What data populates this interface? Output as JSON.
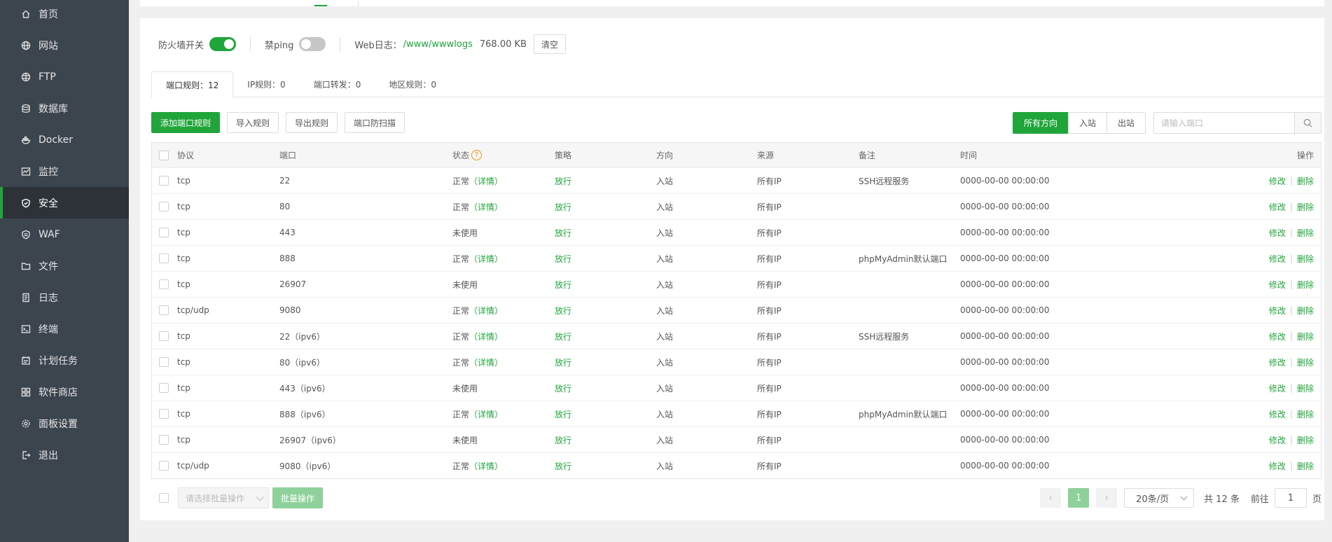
{
  "sidebar": {
    "items": [
      {
        "label": "首页",
        "icon": "home-icon",
        "active": false
      },
      {
        "label": "网站",
        "icon": "globe-icon",
        "active": false
      },
      {
        "label": "FTP",
        "icon": "ftp-globe-icon",
        "active": false
      },
      {
        "label": "数据库",
        "icon": "database-icon",
        "active": false
      },
      {
        "label": "Docker",
        "icon": "docker-icon",
        "active": false
      },
      {
        "label": "监控",
        "icon": "monitor-icon",
        "active": false
      },
      {
        "label": "安全",
        "icon": "shield-icon",
        "active": true
      },
      {
        "label": "WAF",
        "icon": "waf-shield-icon",
        "active": false
      },
      {
        "label": "文件",
        "icon": "folder-icon",
        "active": false
      },
      {
        "label": "日志",
        "icon": "log-icon",
        "active": false
      },
      {
        "label": "终端",
        "icon": "terminal-icon",
        "active": false
      },
      {
        "label": "计划任务",
        "icon": "task-icon",
        "active": false
      },
      {
        "label": "软件商店",
        "icon": "store-icon",
        "active": false
      },
      {
        "label": "面板设置",
        "icon": "gear-icon",
        "active": false
      },
      {
        "label": "退出",
        "icon": "logout-icon",
        "active": false
      }
    ]
  },
  "firewall": {
    "switch_label": "防火墙开关",
    "switch_on": true,
    "ping_label": "禁ping",
    "ping_on": false,
    "weblog_label": "Web日志：",
    "weblog_path": "/www/wwwlogs",
    "weblog_size": "768.00 KB",
    "clear_label": "清空"
  },
  "rule_tabs": [
    {
      "label": "端口规则：12",
      "active": true
    },
    {
      "label": "IP规则：0",
      "active": false
    },
    {
      "label": "端口转发：0",
      "active": false
    },
    {
      "label": "地区规则：0",
      "active": false
    }
  ],
  "toolbar": {
    "add_label": "添加端口规则",
    "import_label": "导入规则",
    "export_label": "导出规则",
    "scan_label": "端口防扫描"
  },
  "direction": {
    "all_label": "所有方向",
    "in_label": "入站",
    "out_label": "出站"
  },
  "search": {
    "placeholder": "请输入端口"
  },
  "table": {
    "headers": {
      "protocol": "协议",
      "port": "端口",
      "status": "状态",
      "policy": "策略",
      "direction": "方向",
      "source": "来源",
      "remark": "备注",
      "time": "时间",
      "ops": "操作"
    },
    "help_glyph": "?",
    "edit_label": "修改",
    "delete_label": "删除",
    "op_sep": "|",
    "rows": [
      {
        "protocol": "tcp",
        "port": "22",
        "status": "正常",
        "detail": "（详情）",
        "policy": "放行",
        "direction": "入站",
        "source": "所有IP",
        "remark": "SSH远程服务",
        "time": "0000-00-00 00:00:00"
      },
      {
        "protocol": "tcp",
        "port": "80",
        "status": "正常",
        "detail": "（详情）",
        "policy": "放行",
        "direction": "入站",
        "source": "所有IP",
        "remark": "",
        "time": "0000-00-00 00:00:00"
      },
      {
        "protocol": "tcp",
        "port": "443",
        "status": "未使用",
        "detail": "",
        "policy": "放行",
        "direction": "入站",
        "source": "所有IP",
        "remark": "",
        "time": "0000-00-00 00:00:00"
      },
      {
        "protocol": "tcp",
        "port": "888",
        "status": "正常",
        "detail": "（详情）",
        "policy": "放行",
        "direction": "入站",
        "source": "所有IP",
        "remark": "phpMyAdmin默认端口",
        "time": "0000-00-00 00:00:00"
      },
      {
        "protocol": "tcp",
        "port": "26907",
        "status": "未使用",
        "detail": "",
        "policy": "放行",
        "direction": "入站",
        "source": "所有IP",
        "remark": "",
        "time": "0000-00-00 00:00:00"
      },
      {
        "protocol": "tcp/udp",
        "port": "9080",
        "status": "正常",
        "detail": "（详情）",
        "policy": "放行",
        "direction": "入站",
        "source": "所有IP",
        "remark": "",
        "time": "0000-00-00 00:00:00"
      },
      {
        "protocol": "tcp",
        "port": "22（ipv6）",
        "status": "正常",
        "detail": "（详情）",
        "policy": "放行",
        "direction": "入站",
        "source": "所有IP",
        "remark": "SSH远程服务",
        "time": "0000-00-00 00:00:00"
      },
      {
        "protocol": "tcp",
        "port": "80（ipv6）",
        "status": "正常",
        "detail": "（详情）",
        "policy": "放行",
        "direction": "入站",
        "source": "所有IP",
        "remark": "",
        "time": "0000-00-00 00:00:00"
      },
      {
        "protocol": "tcp",
        "port": "443（ipv6）",
        "status": "未使用",
        "detail": "",
        "policy": "放行",
        "direction": "入站",
        "source": "所有IP",
        "remark": "",
        "time": "0000-00-00 00:00:00"
      },
      {
        "protocol": "tcp",
        "port": "888（ipv6）",
        "status": "正常",
        "detail": "（详情）",
        "policy": "放行",
        "direction": "入站",
        "source": "所有IP",
        "remark": "phpMyAdmin默认端口",
        "time": "0000-00-00 00:00:00"
      },
      {
        "protocol": "tcp",
        "port": "26907（ipv6）",
        "status": "未使用",
        "detail": "",
        "policy": "放行",
        "direction": "入站",
        "source": "所有IP",
        "remark": "",
        "time": "0000-00-00 00:00:00"
      },
      {
        "protocol": "tcp/udp",
        "port": "9080（ipv6）",
        "status": "正常",
        "detail": "（详情）",
        "policy": "放行",
        "direction": "入站",
        "source": "所有IP",
        "remark": "",
        "time": "0000-00-00 00:00:00"
      }
    ]
  },
  "footer": {
    "batch_placeholder": "请选择批量操作",
    "batch_button": "批量操作",
    "prev_glyph": "‹",
    "next_glyph": "›",
    "current_page": "1",
    "page_size": "20条/页",
    "total": "共 12 条",
    "goto_label": "前往",
    "goto_value": "1",
    "page_unit": "页"
  },
  "colors": {
    "accent": "#20a53a",
    "sidebar_bg": "#3c444d",
    "help": "#f0960e"
  }
}
